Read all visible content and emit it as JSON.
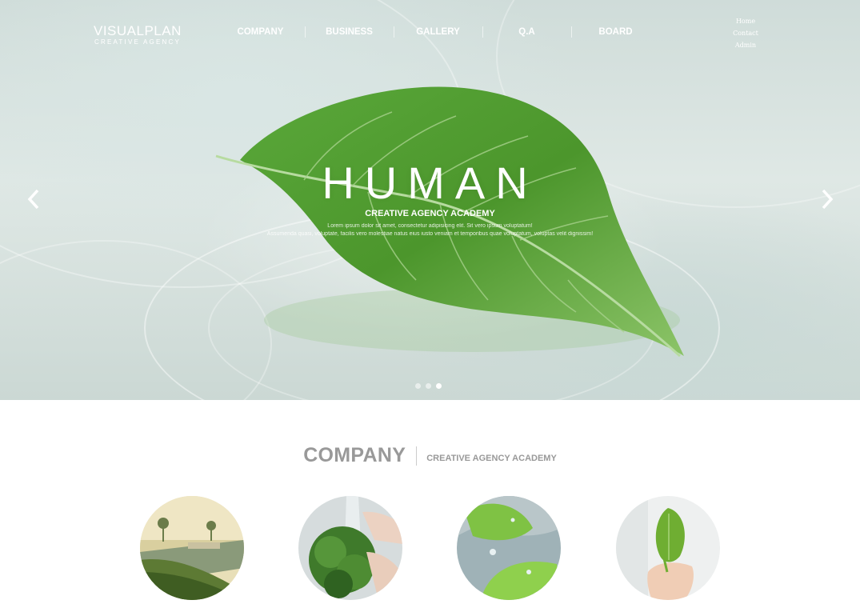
{
  "brand": {
    "name": "VISUALPLAN",
    "tagline": "CREATIVE AGENCY"
  },
  "nav": {
    "items": [
      {
        "label": "COMPANY"
      },
      {
        "label": "BUSINESS"
      },
      {
        "label": "GALLERY"
      },
      {
        "label": "Q.A"
      },
      {
        "label": "BOARD"
      }
    ]
  },
  "util_links": {
    "home": "Home",
    "contact": "Contact",
    "admin": "Admin"
  },
  "hero": {
    "title": "HUMAN",
    "subtitle": "CREATIVE AGENCY ACADEMY",
    "desc_line1": "Lorem ipsum dolor sit amet, consectetur adipisicing elit. Sit vero ipsum voluptatum!",
    "desc_line2": "Assumenda quasi, voluptate, facilis vero molestiae natus eius iusto veniam et temporibus quae voluptatum, voluptas velit dignissim!",
    "prev_icon": "chevron-left-icon",
    "next_icon": "chevron-right-icon",
    "slides_total": 3,
    "active_slide": 3
  },
  "section": {
    "title": "COMPANY",
    "subtitle": "CREATIVE AGENCY ACADEMY"
  },
  "cards": [
    {
      "image": "resort-garden-photo"
    },
    {
      "image": "washing-greens-photo"
    },
    {
      "image": "water-drop-leaf-photo"
    },
    {
      "image": "leaf-in-hand-photo"
    }
  ],
  "colors": {
    "accent_text": "#999999",
    "leaf_green": "#4f9a2c"
  }
}
